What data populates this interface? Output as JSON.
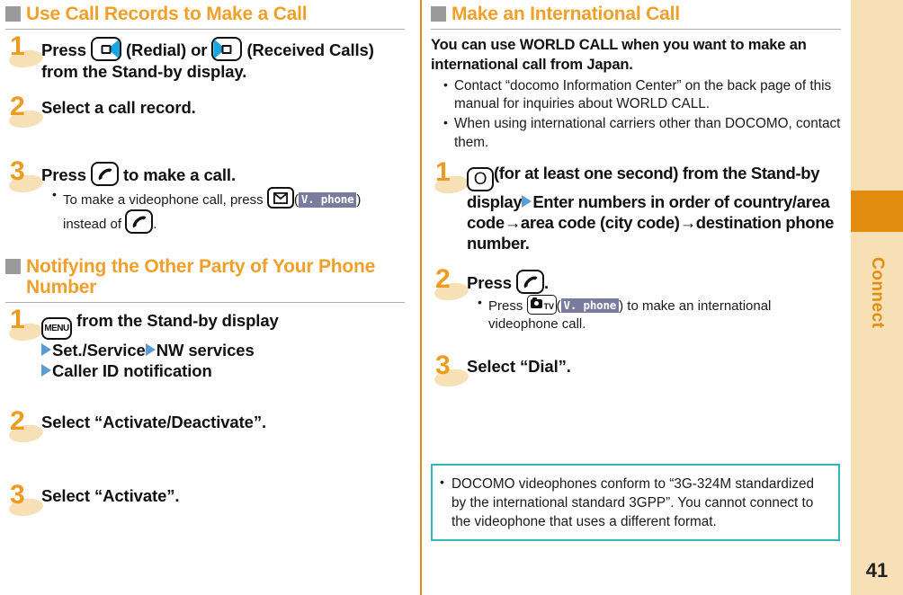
{
  "rail": {
    "chapter_label": "Connect",
    "page_number": "41",
    "band_color": "#E28D10",
    "bg_color": "#F7E0B5"
  },
  "left_column": {
    "sections": [
      {
        "title": "Use Call Records to Make a Call",
        "steps": [
          {
            "number": "1",
            "title_part1": "Press",
            "title_part2": "(Redial) or",
            "title_part3": "(Received Calls) from the Stand-by display.",
            "bullets": []
          },
          {
            "number": "2",
            "title_part1": "Select a call record.",
            "bullets": []
          },
          {
            "number": "3",
            "title_part1": "Press",
            "title_part2": "to make a call.",
            "bullet1_a": "To make a videophone call, press",
            "bullet1_badge": "V. phone",
            "bullet1_b": ") instead of",
            "bullet1_c": "."
          }
        ]
      },
      {
        "title": "Notifying the Other Party of Your Phone Number",
        "steps": [
          {
            "number": "1",
            "key_label": "MENU",
            "line1": "from the Stand-by display",
            "line2a": "Set./Service",
            "line2b": "NW services",
            "line3": "Caller ID notification"
          },
          {
            "number": "2",
            "title_part1": "Select “Activate/Deactivate”."
          },
          {
            "number": "3",
            "title_part1": "Select “Activate”."
          }
        ]
      }
    ]
  },
  "right_column": {
    "section": {
      "title": "Make an International Call",
      "intro": "You can use WORLD CALL when you want to make an international call from Japan.",
      "intro_bullets": [
        "Contact “docomo Information Center” on the back page of this manual for inquiries about WORLD CALL.",
        "When using international carriers other than DOCOMO, contact them."
      ],
      "steps": [
        {
          "number": "1",
          "key_label": "O",
          "text_a": "(for at least one second) from the Stand-by display",
          "text_b": "Enter numbers in order of country/area code→area code (city code)→destination phone number."
        },
        {
          "number": "2",
          "title_part1": "Press",
          "title_part2": ".",
          "bullet_a": "Press",
          "bullet_badge": "V. phone",
          "bullet_b": ") to make an international videophone call."
        },
        {
          "number": "3",
          "title_part1": "Select “Dial”."
        }
      ]
    },
    "note_box": {
      "text": "DOCOMO videophones conform to “3G-324M standardized by the international standard 3GPP”. You cannot connect to the videophone that uses a different format.",
      "border_color": "#2FB8BE"
    }
  },
  "icons": {
    "redial_key": "redial-key-icon",
    "received_calls_key": "received-calls-key-icon",
    "call_key": "call-key-icon",
    "mail_key": "mail-key-icon",
    "menu_key": "menu-key-icon",
    "zero_key": "zero-key-icon",
    "camera_tv_key": "camera-tv-key-icon",
    "arrow": "blue-triangle-arrow-icon"
  },
  "colors": {
    "heading_orange": "#F0A02A",
    "step_number_orange": "#ED9B21",
    "arrow_blue": "#5B9BD5",
    "key_accent_cyan": "#17A7E0",
    "badge_purple": "#7A7C9E"
  }
}
